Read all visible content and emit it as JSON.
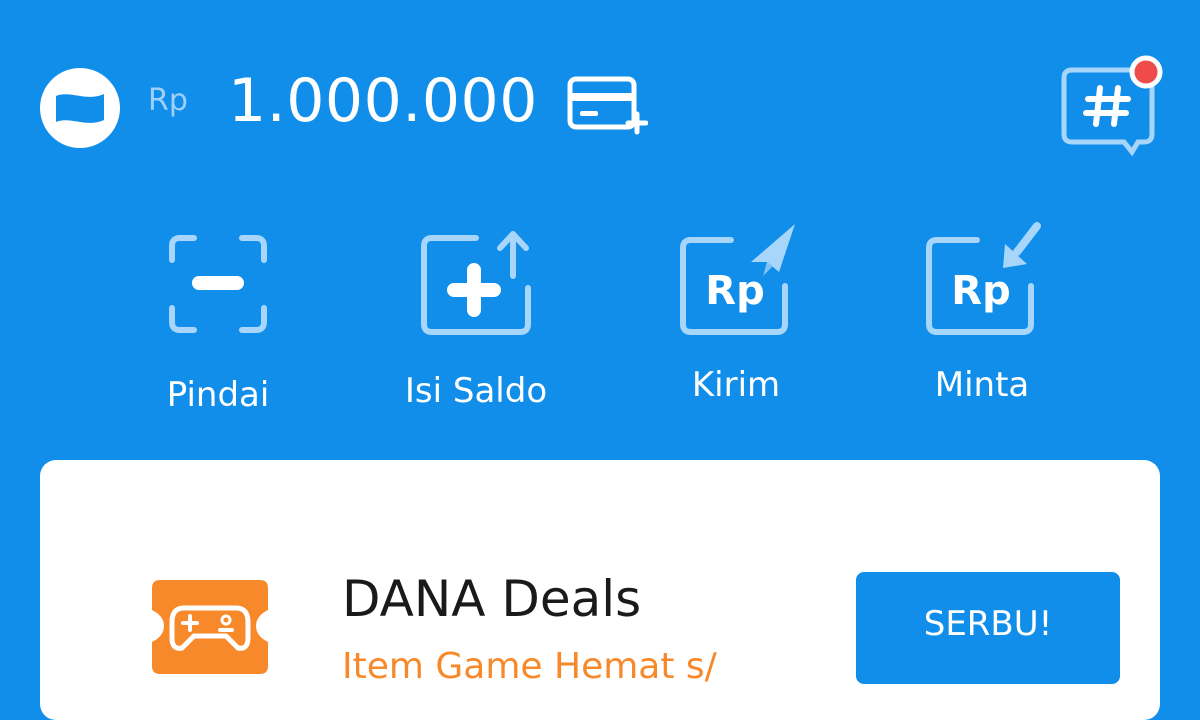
{
  "header": {
    "currency": "Rp",
    "balance": "1.000.000"
  },
  "actions": [
    {
      "label": "Pindai",
      "icon": "scan-icon"
    },
    {
      "label": "Isi Saldo",
      "icon": "top-up-icon"
    },
    {
      "label": "Kirim",
      "icon": "send-money-icon"
    },
    {
      "label": "Minta",
      "icon": "request-money-icon"
    }
  ],
  "action_icon_text": "Rp",
  "promo": {
    "title": "DANA Deals",
    "subtitle": "Item Game Hemat s/",
    "button_label": "SERBU!",
    "icon": "game-controller-ticket-icon"
  },
  "colors": {
    "primary": "#118EEA",
    "icon_tint": "#A8D6FB",
    "promo_orange": "#F7892B",
    "notification_red": "#F04B4B"
  }
}
